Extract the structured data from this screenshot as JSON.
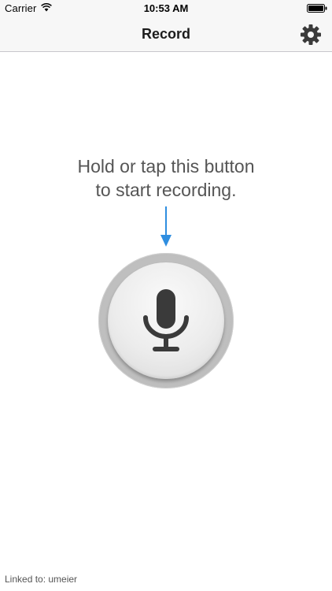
{
  "status_bar": {
    "carrier": "Carrier",
    "time": "10:53 AM",
    "wifi_icon": "wifi-icon",
    "battery_icon": "battery-icon"
  },
  "nav": {
    "title": "Record",
    "settings_icon": "gear-icon"
  },
  "main": {
    "instruction_line1": "Hold or tap this button",
    "instruction_line2": "to start recording.",
    "arrow_icon": "arrow-down-icon",
    "record_button_icon": "microphone-icon"
  },
  "footer": {
    "linked_to": "Linked to: umeier"
  },
  "colors": {
    "accent_arrow": "#2f8ee0",
    "mic": "#3a3a3a",
    "instruction_text": "#555555"
  }
}
